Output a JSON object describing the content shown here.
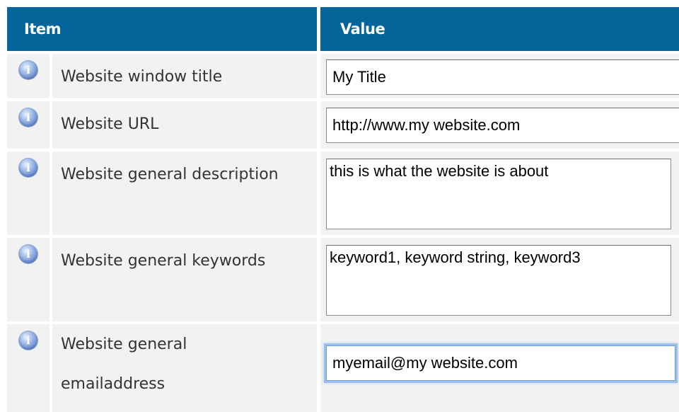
{
  "table": {
    "header": {
      "item_label": "Item",
      "value_label": "Value"
    },
    "rows": [
      {
        "icon": "info-icon",
        "label": "Website window title",
        "value": "My Title",
        "control": "text"
      },
      {
        "icon": "info-icon",
        "label": "Website URL",
        "value": "http://www.my website.com",
        "control": "text"
      },
      {
        "icon": "info-icon",
        "label": "Website general description",
        "value": "this is what the website is about",
        "control": "textarea"
      },
      {
        "icon": "info-icon",
        "label": "Website general keywords",
        "value": "keyword1, keyword string, keyword3",
        "control": "textarea"
      },
      {
        "icon": "info-icon",
        "label_line1": "Website general",
        "label_line2": "emailaddress",
        "value": "myemail@my website.com",
        "control": "text",
        "focused": true
      }
    ]
  },
  "colors": {
    "header_bg": "#03659a",
    "header_text": "#ffffff",
    "row_bg": "#f2f2f2",
    "label_text": "#333333",
    "focus_ring": "#9bc0ee"
  }
}
